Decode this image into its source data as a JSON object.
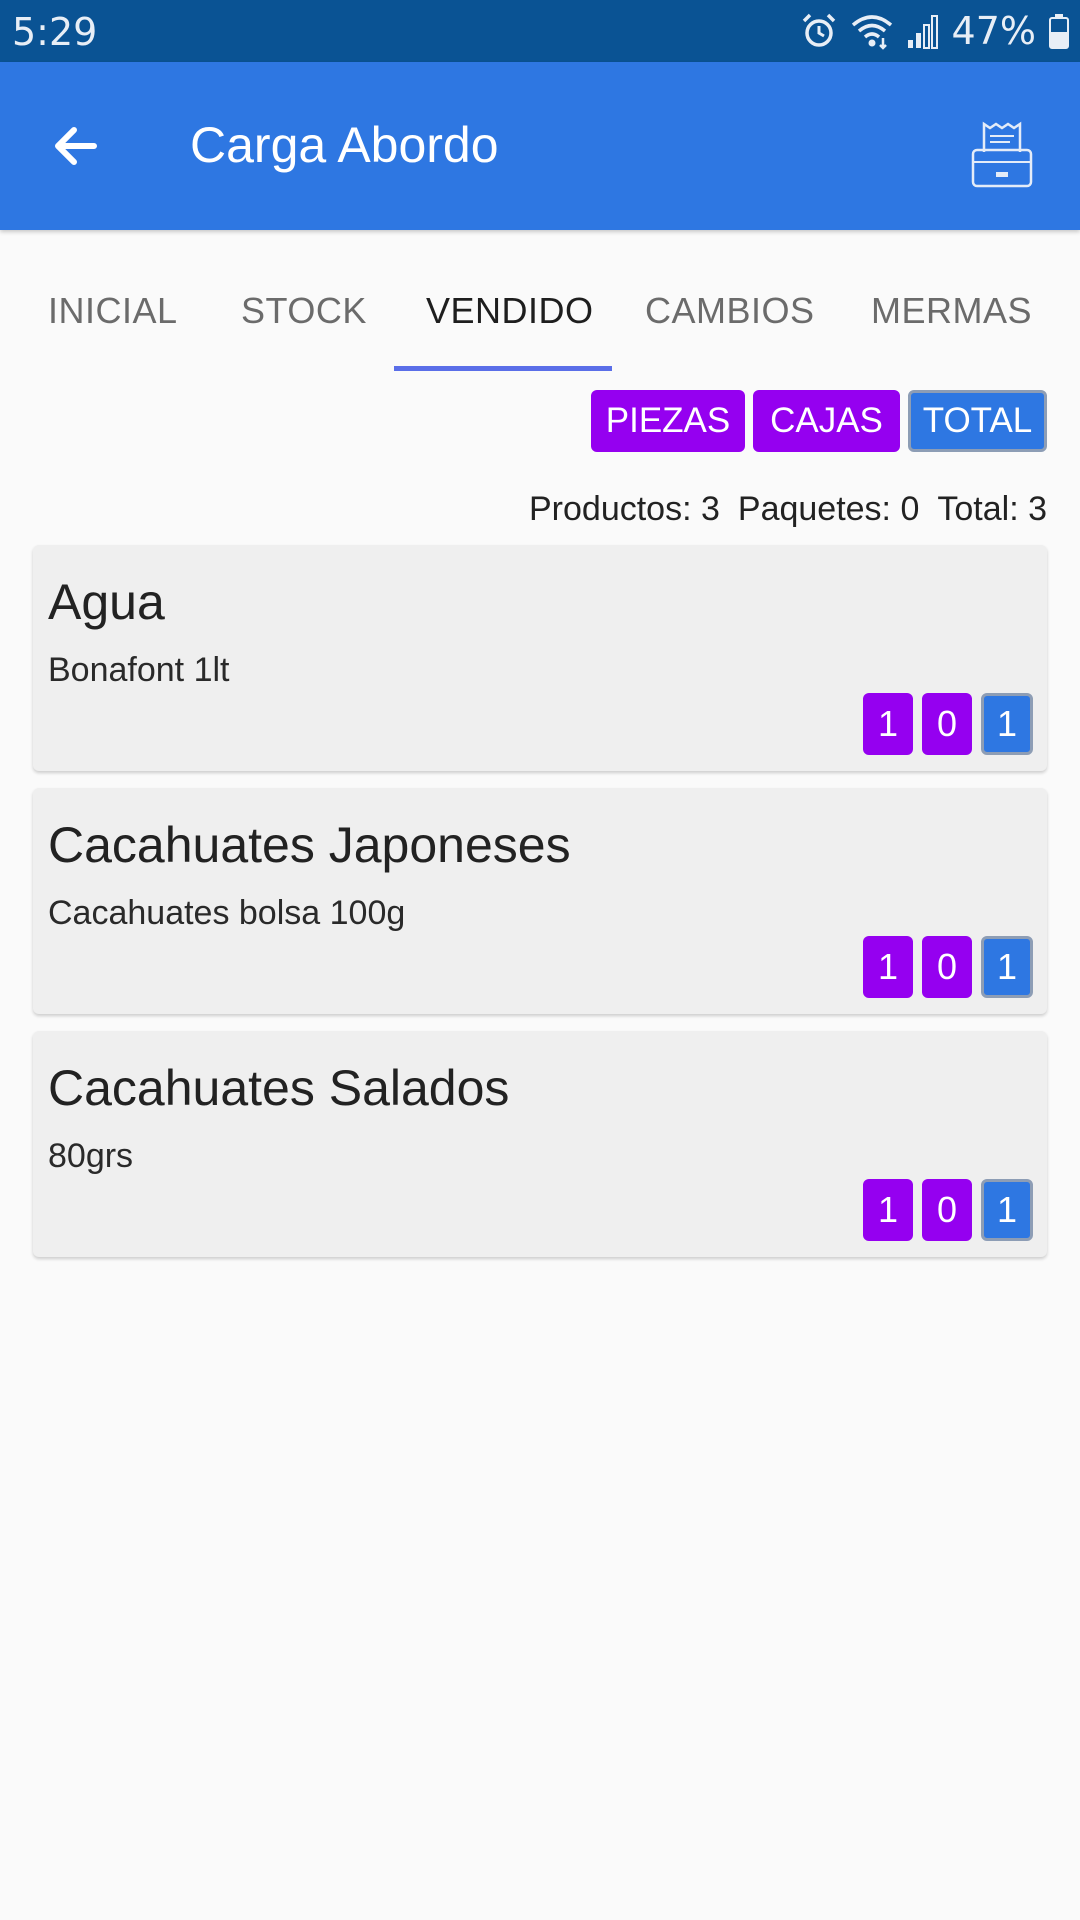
{
  "status_bar": {
    "time": "5:29",
    "battery_percent": "47%",
    "icons": [
      "alarm-icon",
      "wifi-icon",
      "signal-icon",
      "battery-icon"
    ]
  },
  "app_bar": {
    "title": "Carga Abordo",
    "back_icon": "arrow-left-icon",
    "action_icon": "printer-icon",
    "color": "#2e77e2"
  },
  "tabs": [
    {
      "label": "INICIAL",
      "active": false
    },
    {
      "label": "STOCK",
      "active": false
    },
    {
      "label": "VENDIDO",
      "active": true
    },
    {
      "label": "CAMBIOS",
      "active": false
    },
    {
      "label": "MERMAS",
      "active": false
    }
  ],
  "toggles": [
    {
      "label": "PIEZAS",
      "color": "#9500f0"
    },
    {
      "label": "CAJAS",
      "color": "#9500f0"
    },
    {
      "label": "TOTAL",
      "color": "#2e77e2"
    }
  ],
  "summary": {
    "productos": "Productos: 3",
    "paquetes": "Paquetes: 0",
    "total": "Total: 3"
  },
  "products": [
    {
      "name": "Agua",
      "description": "Bonafont 1lt",
      "piezas": "1",
      "cajas": "0",
      "total": "1"
    },
    {
      "name": "Cacahuates Japoneses",
      "description": "Cacahuates bolsa 100g",
      "piezas": "1",
      "cajas": "0",
      "total": "1"
    },
    {
      "name": "Cacahuates Salados",
      "description": "80grs",
      "piezas": "1",
      "cajas": "0",
      "total": "1"
    }
  ]
}
